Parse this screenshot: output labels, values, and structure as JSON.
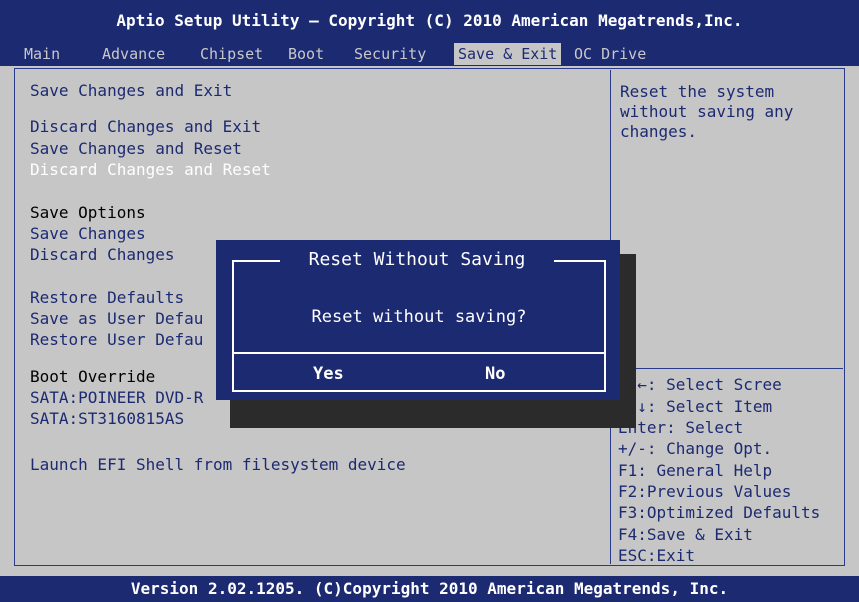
{
  "header": {
    "title": "Aptio Setup Utility – Copyright (C) 2010 American Megatrends,Inc."
  },
  "menu": {
    "tabs": [
      "Main",
      "Advance",
      "Chipset",
      "Boot",
      "Security",
      "Save & Exit",
      "OC Drive"
    ],
    "active": "Save & Exit"
  },
  "left": {
    "save_changes_and_exit": "Save Changes and Exit",
    "discard_changes_and_exit": "Discard Changes and Exit",
    "save_changes_and_reset": "Save Changes and Reset",
    "discard_changes_and_reset": "Discard Changes and Reset",
    "save_options_header": "Save Options",
    "save_changes": "Save Changes",
    "discard_changes": "Discard Changes",
    "restore_defaults": "Restore Defaults",
    "save_as_user_defaults": "Save as User Defau",
    "restore_user_defaults": "Restore User Defau",
    "boot_override_header": "Boot Override",
    "boot_sata_dvd": "SATA:POINEER DVD-R",
    "boot_sata_hdd": "SATA:ST3160815AS",
    "launch_efi_shell": "Launch EFI Shell from filesystem device"
  },
  "help": {
    "text": "Reset the system\nwithout saving any\nchanges."
  },
  "legend": {
    "select_screen": "→ ←:  Select Scree",
    "select_item": "↑ ↓:  Select Item",
    "enter_select": "Enter: Select",
    "change_opt": "+/-:   Change Opt.",
    "f1": "F1: General Help",
    "f2": "F2:Previous Values",
    "f3": "F3:Optimized Defaults",
    "f4": "F4:Save & Exit",
    "esc": "ESC:Exit"
  },
  "dialog": {
    "title": "Reset Without Saving",
    "message": "Reset without saving?",
    "yes": "Yes",
    "no": "No"
  },
  "footer": {
    "text": "Version 2.02.1205. (C)Copyright 2010 American Megatrends, Inc."
  },
  "colors": {
    "accent": "#1c2a72",
    "background": "#c6c6c6",
    "selected_text": "#ffffff"
  }
}
